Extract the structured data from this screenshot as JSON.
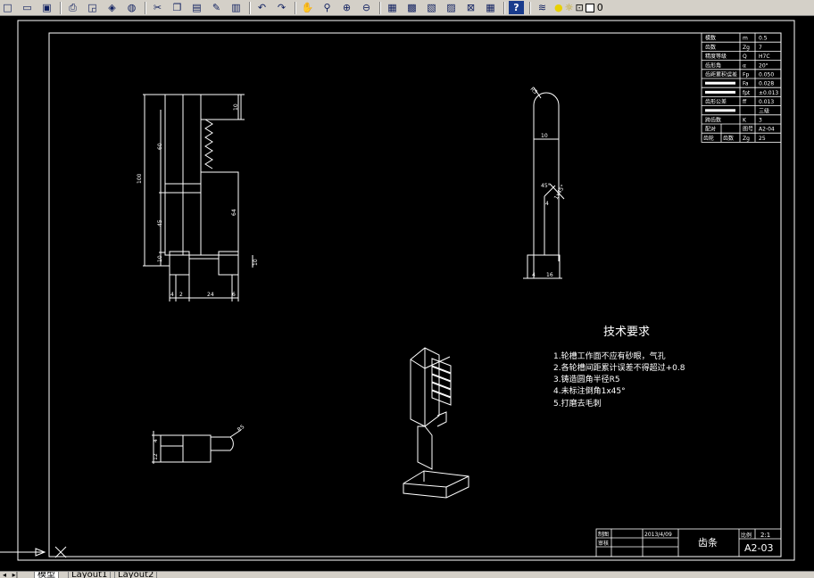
{
  "toolbar": {
    "buttons": [
      {
        "name": "new-icon"
      },
      {
        "name": "open-icon"
      },
      {
        "name": "save-icon"
      },
      {
        "name": "print-icon"
      },
      {
        "name": "print-preview-icon"
      },
      {
        "name": "plot-icon"
      },
      {
        "name": "publish-icon"
      },
      {
        "name": "cut-icon"
      },
      {
        "name": "copy-icon"
      },
      {
        "name": "paste-icon"
      },
      {
        "name": "match-properties-icon"
      },
      {
        "name": "block-editor-icon"
      },
      {
        "name": "undo-icon"
      },
      {
        "name": "redo-icon"
      },
      {
        "name": "pan-icon"
      },
      {
        "name": "zoom-realtime-icon"
      },
      {
        "name": "zoom-window-icon"
      },
      {
        "name": "zoom-previous-icon"
      },
      {
        "name": "properties-icon"
      },
      {
        "name": "design-center-icon"
      },
      {
        "name": "tool-palettes-icon"
      },
      {
        "name": "sheet-set-icon"
      },
      {
        "name": "markup-icon"
      },
      {
        "name": "calculator-icon"
      },
      {
        "name": "help-icon"
      },
      {
        "name": "layer-manager-icon"
      }
    ],
    "layer_value": "0"
  },
  "drawing": {
    "tech_title": "技术要求",
    "tech_items": [
      "1.轮槽工作面不应有砂眼，气孔",
      "2.各轮槽间距累计误差不得超过+0.8",
      "3.铸造圆角半径R5",
      "4.未标注倒角1x45°",
      "5.打磨去毛刺"
    ],
    "param_table": [
      [
        "模数",
        "m",
        "0.5"
      ],
      [
        "齿数",
        "Zg",
        "7"
      ],
      [
        "精度等级",
        "Q",
        "H7C"
      ],
      [
        "齿形角",
        "α",
        "20°"
      ],
      [
        "齿距累积误差",
        "Fp",
        "0.050"
      ],
      [
        "",
        "Fa",
        "0.028"
      ],
      [
        "",
        "fpt",
        "±0.013"
      ],
      [
        "齿形公差",
        "ff",
        "0.013"
      ],
      [
        "",
        "",
        "三级"
      ],
      [
        "跨齿数",
        "K",
        "3"
      ],
      [
        "配对",
        "图号",
        "A2-04"
      ],
      [
        "齿轮",
        "齿数",
        "Zg",
        "25"
      ]
    ],
    "title_block": {
      "date": "2013/4/09",
      "part_name": "齿条",
      "scale_label": "比例",
      "scale_value": "2:1",
      "drawing_no": "A2-03",
      "row_label_1": "制图",
      "row_label_2": "审核"
    },
    "dims_front": {
      "d_total": "100",
      "d_upper": "60",
      "d_mid": "45",
      "d_low": "10",
      "d_top": "10",
      "d_right_mid": "64",
      "d_right_low": "10",
      "b1": "4",
      "b2": "2",
      "b3": "24",
      "b4": "6"
    },
    "dims_side": {
      "r_top": "R5",
      "w_body": "10",
      "angle": "45°",
      "h_small": "4",
      "c_small": "1x45°",
      "b1": "4",
      "b2": "16"
    },
    "dims_top": {
      "r": "R5",
      "h1": "4",
      "h2": "12"
    }
  },
  "tabs": [
    "模型",
    "Layout1",
    "Layout2"
  ]
}
